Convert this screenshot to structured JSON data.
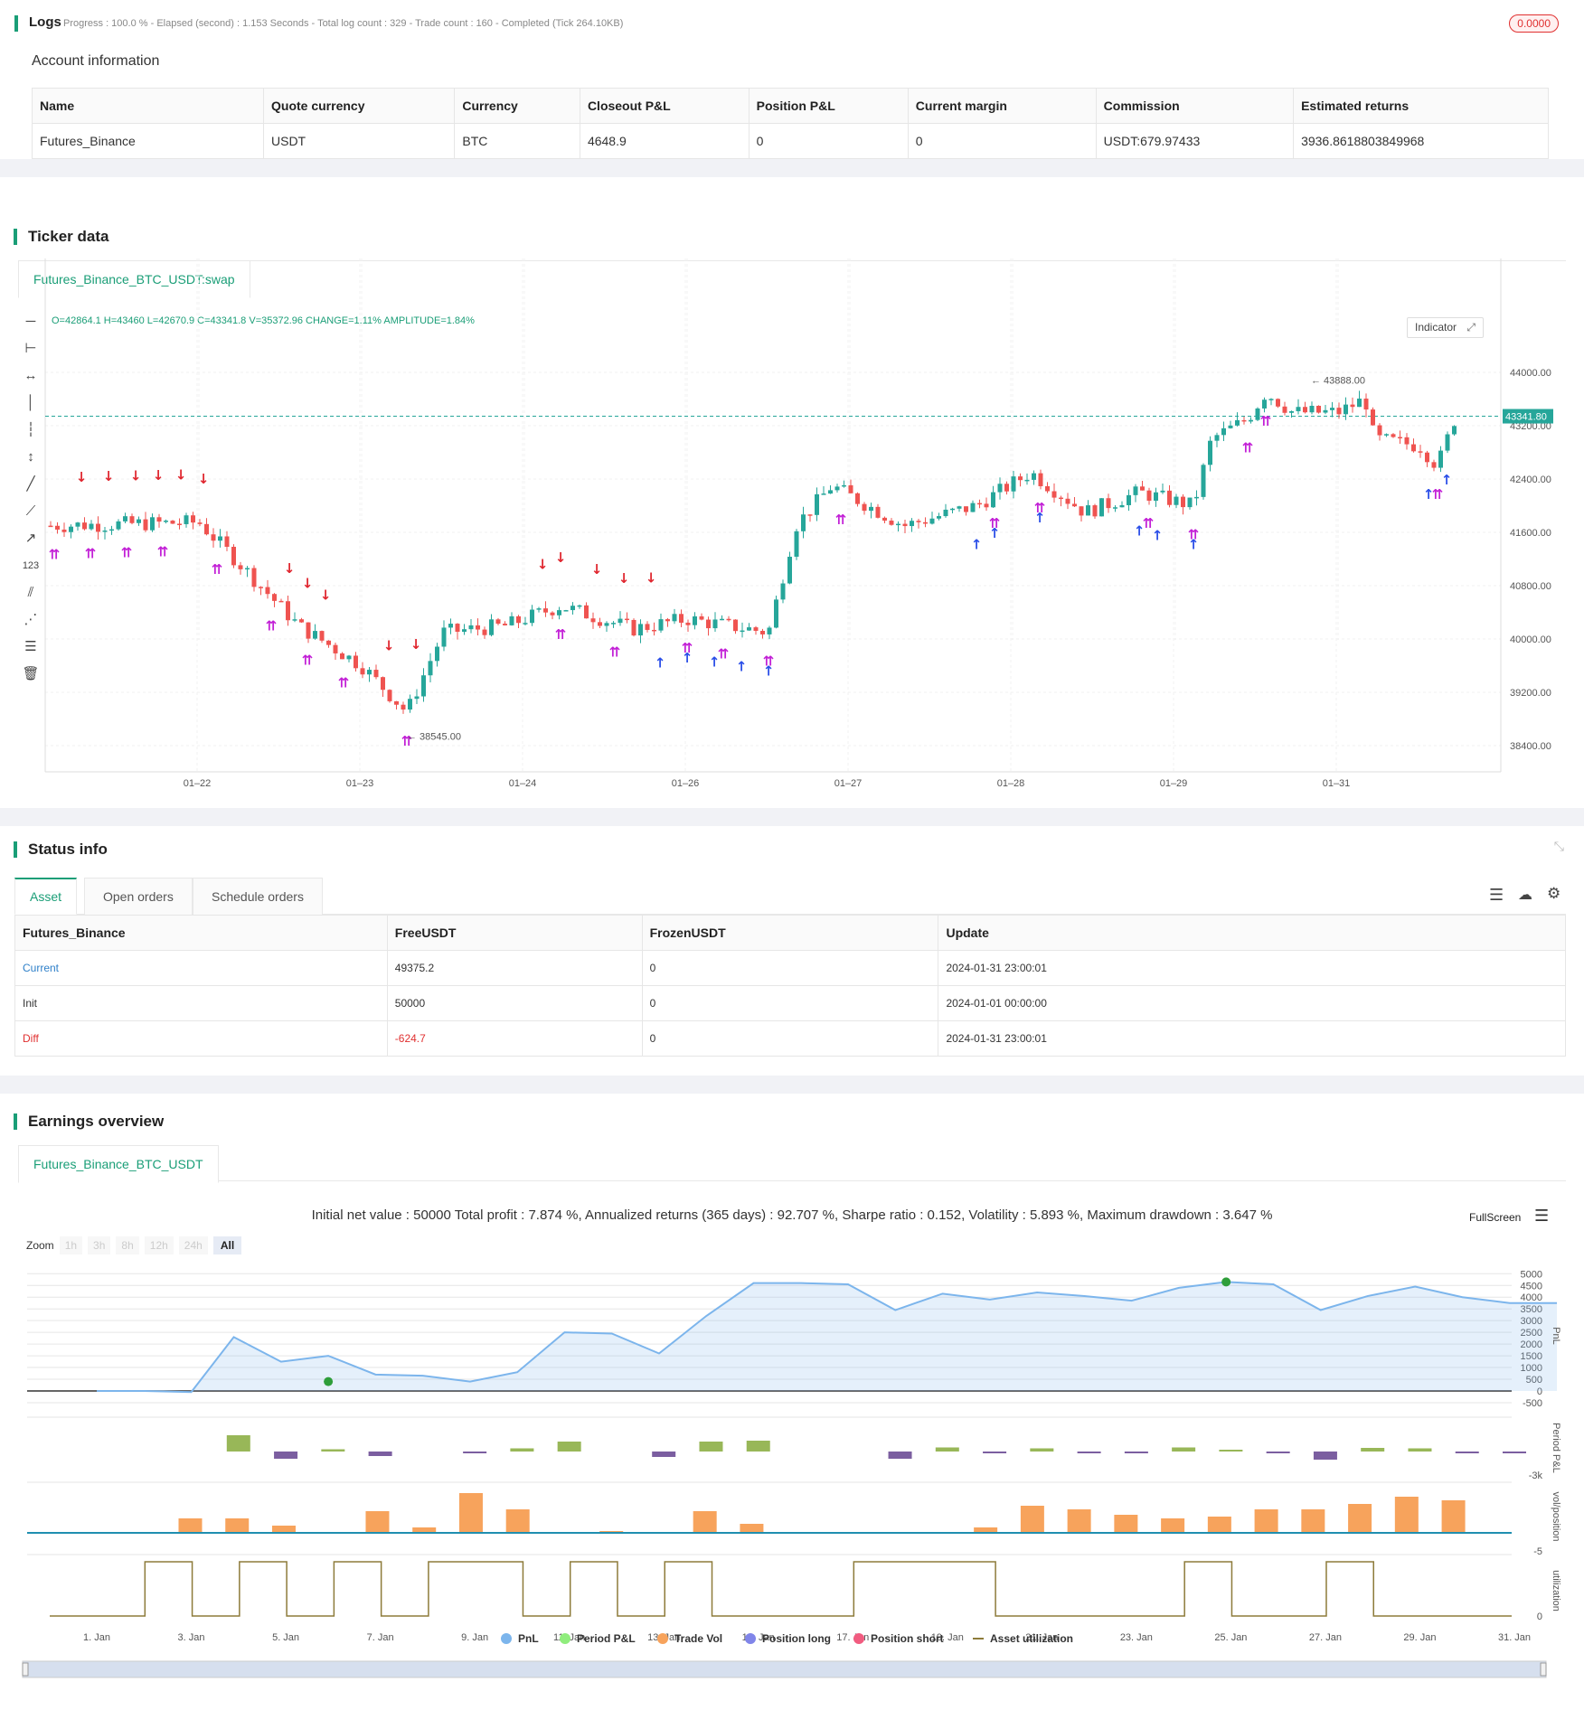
{
  "logs": {
    "title": "Logs",
    "summary": "Progress : 100.0 % - Elapsed (second) : 1.153  Seconds - Total log count : 329 - Trade count : 160 - Completed (Tick 264.10KB)",
    "badge": "0.0000"
  },
  "account": {
    "title": "Account information",
    "columns": [
      "Name",
      "Quote currency",
      "Currency",
      "Closeout P&L",
      "Position P&L",
      "Current margin",
      "Commission",
      "Estimated returns"
    ],
    "row": [
      "Futures_Binance",
      "USDT",
      "BTC",
      "4648.9",
      "0",
      "0",
      "USDT:679.97433",
      "3936.8618803849968"
    ]
  },
  "ticker": {
    "title": "Ticker data",
    "tab": "Futures_Binance_BTC_USDT:swap",
    "ohlc": "O=42864.1 H=43460 L=42670.9 C=43341.8 V=35372.96 CHANGE=1.11% AMPLITUDE=1.84%",
    "indicator_btn": "Indicator",
    "price_tag": "43341.80",
    "high_note": "43888.00",
    "low_note": "38545.00",
    "y_ticks": [
      "44000.00",
      "43200.00",
      "42400.00",
      "41600.00",
      "40800.00",
      "40000.00",
      "39200.00",
      "38400.00"
    ],
    "x_ticks": [
      "01–22",
      "01–23",
      "01–24",
      "01–26",
      "01–27",
      "01–28",
      "01–29",
      "01–31"
    ],
    "colors": {
      "up": "#26a69a",
      "down": "#ef5350",
      "short": "#e0262f",
      "long": "#2a4ee8",
      "close": "#c21fd6"
    }
  },
  "status": {
    "title": "Status info",
    "tabs": [
      "Asset",
      "Open orders",
      "Schedule orders"
    ],
    "columns": [
      "Futures_Binance",
      "FreeUSDT",
      "FrozenUSDT",
      "Update"
    ],
    "rows": [
      [
        "Current",
        "49375.2",
        "0",
        "2024-01-31 23:00:01"
      ],
      [
        "Init",
        "50000",
        "0",
        "2024-01-01 00:00:00"
      ],
      [
        "Diff",
        "-624.7",
        "0",
        "2024-01-31 23:00:01"
      ]
    ]
  },
  "earnings": {
    "title": "Earnings overview",
    "tab": "Futures_Binance_BTC_USDT",
    "summary": "Initial net value : 50000 Total profit : 7.874 %, Annualized returns (365 days) : 92.707 %, Sharpe ratio : 0.152, Volatility : 5.893 %, Maximum drawdown : 3.647 %",
    "fullscreen": "FullScreen",
    "zoom_label": "Zoom",
    "zoom_options": [
      "1h",
      "3h",
      "8h",
      "12h",
      "24h",
      "All"
    ],
    "pnl_ticks": [
      "5000",
      "4500",
      "4000",
      "3500",
      "3000",
      "2500",
      "2000",
      "1500",
      "1000",
      "500",
      "0",
      "-500"
    ],
    "axis_titles": [
      "PnL",
      "Period P&L",
      "vol/position",
      "utilization"
    ],
    "period_tick": "-3k",
    "vol_tick": "-5",
    "util_tick": "0",
    "x_ticks": [
      "1. Jan",
      "3. Jan",
      "5. Jan",
      "7. Jan",
      "9. Jan",
      "11. Jan",
      "13. Jan",
      "15. Jan",
      "17. Jan",
      "19. Jan",
      "21. Jan",
      "23. Jan",
      "25. Jan",
      "27. Jan",
      "29. Jan",
      "31. Jan"
    ],
    "legend": [
      "PnL",
      "Period P&L",
      "Trade Vol",
      "Position long",
      "Position short",
      "Asset utilization"
    ],
    "legend_colors": [
      "#7cb5ec",
      "#90ed7d",
      "#f7a35c",
      "#8085e9",
      "#f15c80",
      "#8d7b3a"
    ],
    "chart_data": {
      "type": "line",
      "series": [
        {
          "name": "PnL",
          "x_days": [
            1,
            2,
            3,
            3.9,
            4.9,
            5.9,
            6.9,
            7.9,
            8.9,
            9.9,
            10.9,
            11.9,
            12.9,
            13.9,
            14.9,
            15.9,
            16.9,
            17.9,
            18.9,
            19.9,
            20.9,
            21.9,
            22.9,
            23.9,
            24.9,
            25.9,
            26.9,
            27.9,
            28.9,
            29.9,
            30.9,
            31.9
          ],
          "values": [
            0,
            0,
            -50,
            2300,
            1250,
            1500,
            700,
            650,
            400,
            800,
            2500,
            2450,
            1600,
            3200,
            4600,
            4600,
            4550,
            3450,
            4150,
            3900,
            4200,
            4050,
            3850,
            4400,
            4650,
            4550,
            3450,
            4050,
            4450,
            4000,
            3750,
            3750
          ]
        },
        {
          "name": "Period P&L",
          "values": [
            0,
            0,
            0,
            1800,
            -800,
            250,
            -500,
            0,
            -100,
            350,
            1100,
            0,
            -600,
            1100,
            1200,
            0,
            0,
            -800,
            450,
            -150,
            350,
            -100,
            -100,
            450,
            200,
            -50,
            -900,
            400,
            350,
            -150,
            -150
          ]
        }
      ],
      "ylim": [
        -500,
        5000
      ]
    }
  }
}
